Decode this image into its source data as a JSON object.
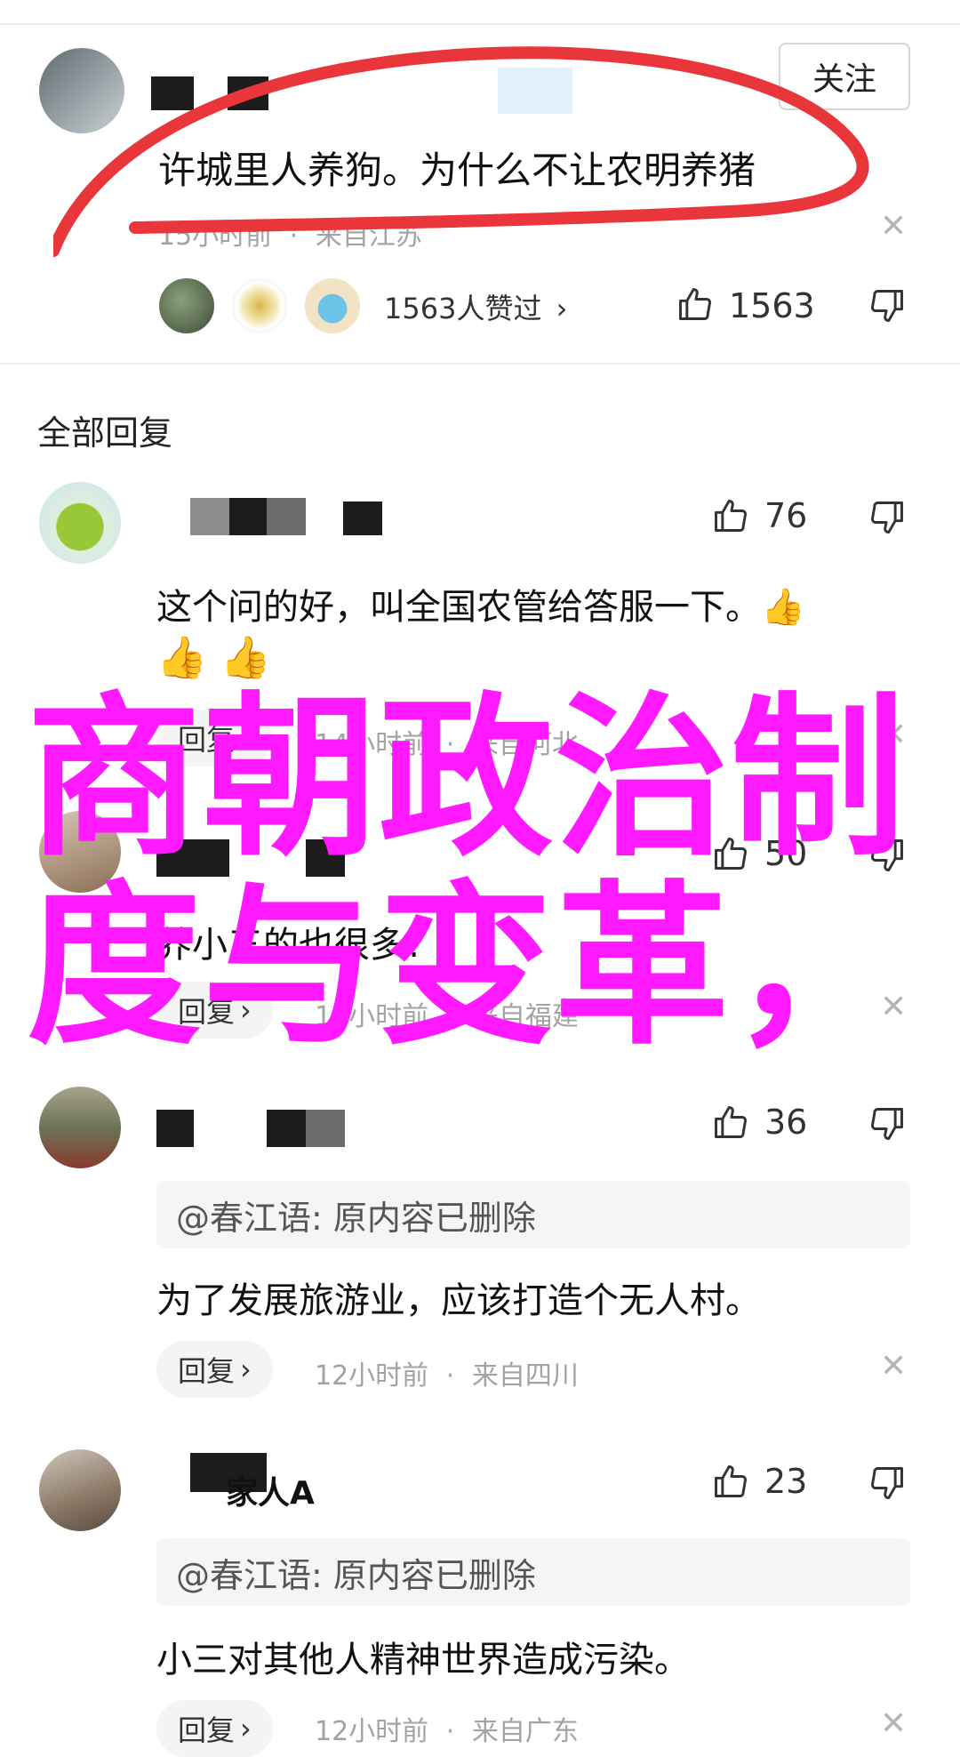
{
  "top_post": {
    "follow_label": "关注",
    "content": "许城里人养狗。为什么不让农明养猪",
    "time": "15小时前",
    "location": "来自江苏",
    "likers_text": "1563人赞过",
    "like_count": "1563"
  },
  "section_title": "全部回复",
  "replies": [
    {
      "like_count": "76",
      "content": "这个问的好，叫全国农管给答服一下。👍",
      "emoji_line": "👍 👍",
      "reply_label": "回复",
      "time": "14小时前",
      "location": "来自河北"
    },
    {
      "like_count": "50",
      "content": "养小三的也很多?",
      "reply_label": "回复",
      "time": "13小时前",
      "location": "来自福建"
    },
    {
      "like_count": "36",
      "quote": "@春江语: 原内容已删除",
      "content": "为了发展旅游业，应该打造个无人村。",
      "reply_label": "回复",
      "time": "12小时前",
      "location": "来自四川"
    },
    {
      "name_partial": "家人A",
      "like_count": "23",
      "quote": "@春江语: 原内容已删除",
      "content": "小三对其他人精神世界造成污染。",
      "reply_label": "回复",
      "time": "12小时前",
      "location": "来自广东"
    }
  ],
  "meta_separator": "·",
  "reply_chevron": "›",
  "overlay_title": "商朝政治制度与变革，",
  "colors": {
    "overlay": "#ff19ff",
    "annotation_red": "#e8363a"
  }
}
